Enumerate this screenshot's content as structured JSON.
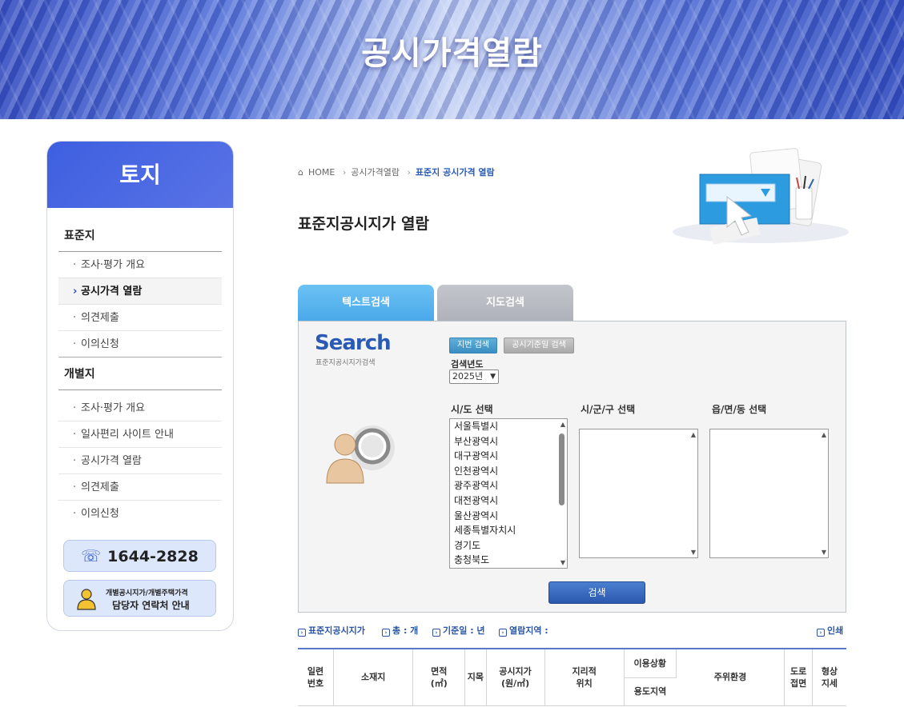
{
  "banner": {
    "title": "공시가격열람"
  },
  "sidebar": {
    "title": "토지",
    "group1": {
      "title": "표준지",
      "items": [
        {
          "label": "조사·평가 개요"
        },
        {
          "label": "공시가격 열람"
        },
        {
          "label": "의견제출"
        },
        {
          "label": "이의신청"
        }
      ]
    },
    "group2": {
      "title": "개별지",
      "items": [
        {
          "label": "조사·평가 개요"
        },
        {
          "label": "일사편리 사이트 안내"
        },
        {
          "label": "공시가격 열람"
        },
        {
          "label": "의견제출"
        },
        {
          "label": "이의신청"
        }
      ]
    },
    "phone": "1644-2828",
    "contact_line1": "개별공시지가/개별주택가격",
    "contact_line2": "담당자 연락처 안내"
  },
  "breadcrumb": {
    "home": "HOME",
    "level1": "공시가격열람",
    "current": "표준지 공시가격 열람"
  },
  "page_title": "표준지공시지가 열람",
  "tabs": {
    "text_search": "텍스트검색",
    "map_search": "지도검색"
  },
  "search": {
    "logo": "Search",
    "logo_sub": "표준지공시지가검색",
    "btn_jibun": "지번 검색",
    "btn_date": "공시기준일 검색",
    "year_label": "검색년도",
    "year_value": "2025년",
    "sido_label": "시/도 선택",
    "sigungu_label": "시/군/구 선택",
    "eupmyeon_label": "읍/면/동 선택",
    "sido_options": [
      "서울특별시",
      "부산광역시",
      "대구광역시",
      "인천광역시",
      "광주광역시",
      "대전광역시",
      "울산광역시",
      "세종특별자치시",
      "경기도",
      "충청북도"
    ],
    "search_button": "검색"
  },
  "info": {
    "standard": "표준지공시지가",
    "total": "총 : 개",
    "base_date": "기준일 : 년",
    "area": "열람지역 :",
    "print": "인쇄"
  },
  "table": {
    "h_serial": "일련\n번호",
    "h_location": "소재지",
    "h_area": "면적\n(㎡)",
    "h_category": "지목",
    "h_price": "공시지가\n(원/㎡)",
    "h_geo": "지리적\n위치",
    "h_usage": "이용상황",
    "h_zone": "용도지역",
    "h_surroundings": "주위환경",
    "h_road": "도로\n접면",
    "h_shape": "형상\n지세"
  }
}
